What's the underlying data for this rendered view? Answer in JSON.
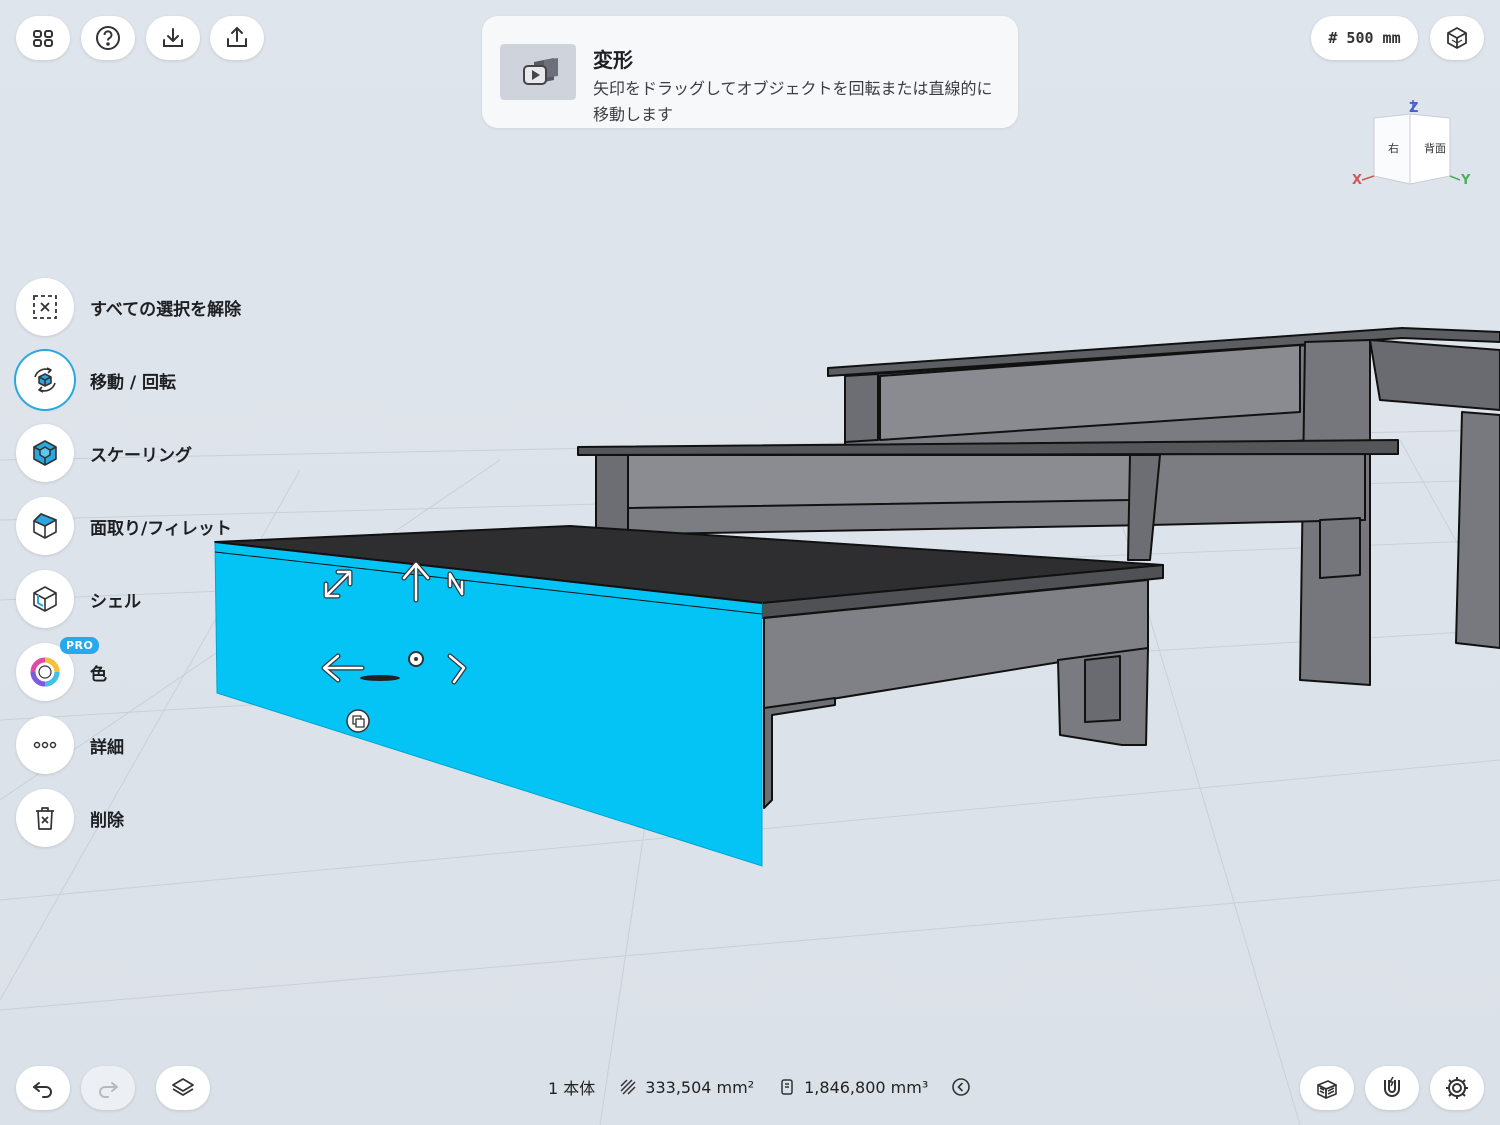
{
  "top_left_buttons": [
    {
      "icon": "grid-menu-icon"
    },
    {
      "icon": "help-icon"
    },
    {
      "icon": "import-icon"
    },
    {
      "icon": "export-icon"
    }
  ],
  "banner": {
    "title": "変形",
    "text": "矢印をドラッグしてオブジェクトを回転または直線的に移動します",
    "thumbnail_icon": "video-play-icon"
  },
  "grid_size": "# 500 mm",
  "view_mode_icon": "perspective-cube-icon",
  "view_cube": {
    "face_right": "右",
    "face_back": "背面",
    "axis_z": "Z",
    "axis_x": "X",
    "axis_y": "Y"
  },
  "tools": [
    {
      "label": "すべての選択を解除",
      "icon": "deselect-icon",
      "active": false
    },
    {
      "label": "移動 / 回転",
      "icon": "move-rotate-icon",
      "active": true
    },
    {
      "label": "スケーリング",
      "icon": "scale-icon",
      "active": false
    },
    {
      "label": "面取り/フィレット",
      "icon": "chamfer-icon",
      "active": false
    },
    {
      "label": "シェル",
      "icon": "shell-icon",
      "active": false
    },
    {
      "label": "色",
      "icon": "color-wheel-icon",
      "active": false,
      "badge": "PRO"
    },
    {
      "label": "詳細",
      "icon": "more-icon",
      "active": false
    },
    {
      "label": "削除",
      "icon": "trash-icon",
      "active": false
    }
  ],
  "status_bar": {
    "bodies": "1 本体",
    "area": "333,504 mm²",
    "volume": "1,846,800 mm³"
  },
  "colors": {
    "selection": "#04c3f5",
    "furniture": "#7c7d82",
    "furniture_top": "#3a3a3d",
    "background": "#dde3ea",
    "accent": "#2aa7e0"
  }
}
